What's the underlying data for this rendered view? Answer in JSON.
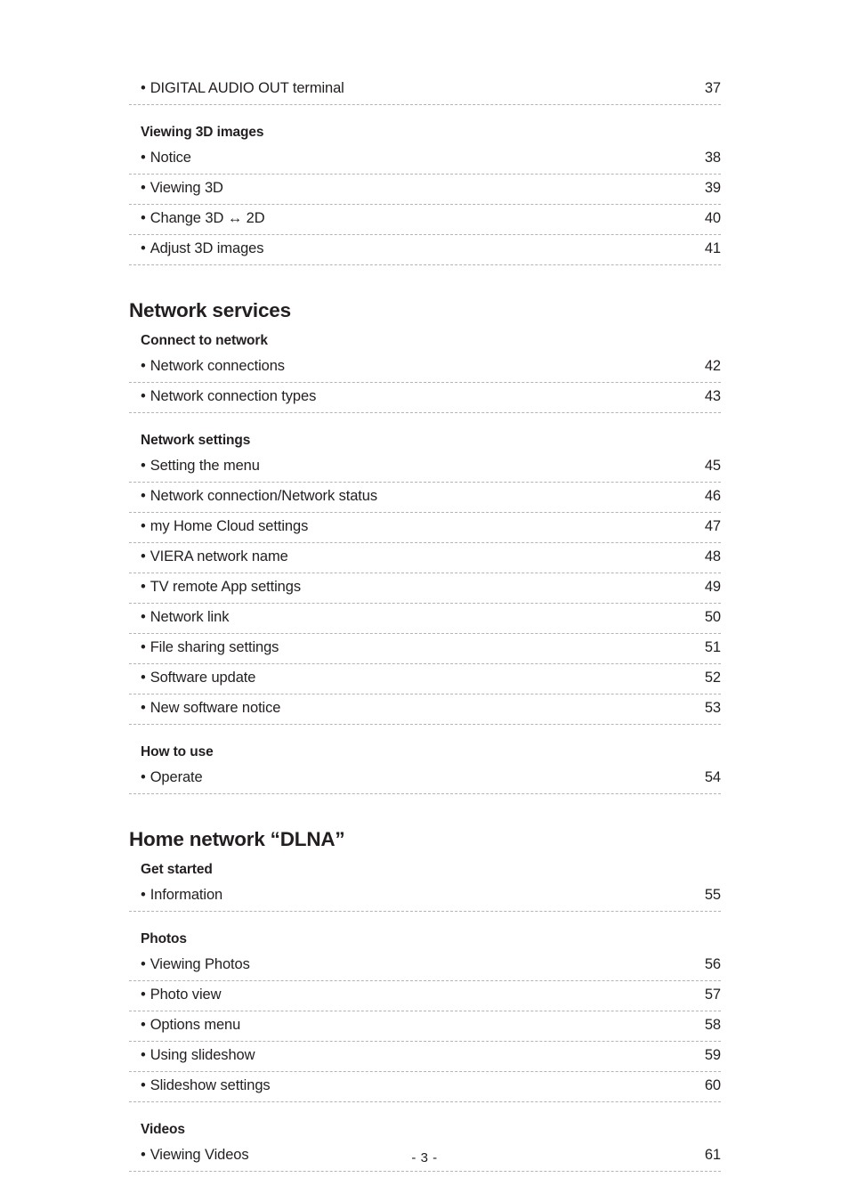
{
  "document": {
    "footer_page_label": "- 3 -",
    "bullet_glyph": "•"
  },
  "toc": {
    "blocks": [
      {
        "section_title": null,
        "groups": [
          {
            "heading": null,
            "entries": [
              {
                "label": "DIGITAL AUDIO OUT terminal",
                "page": "37"
              }
            ]
          },
          {
            "heading": "Viewing 3D images",
            "entries": [
              {
                "label": "Notice",
                "page": "38"
              },
              {
                "label": "Viewing 3D",
                "page": "39"
              },
              {
                "label": "Change 3D ↔ 2D",
                "page": "40"
              },
              {
                "label": "Adjust 3D images",
                "page": "41"
              }
            ]
          }
        ]
      },
      {
        "section_title": "Network services",
        "groups": [
          {
            "heading": "Connect to network",
            "entries": [
              {
                "label": "Network connections",
                "page": "42"
              },
              {
                "label": "Network connection types",
                "page": "43"
              }
            ]
          },
          {
            "heading": "Network settings",
            "entries": [
              {
                "label": "Setting the menu",
                "page": "45"
              },
              {
                "label": "Network connection/Network status",
                "page": "46"
              },
              {
                "label": "my Home Cloud settings",
                "page": "47"
              },
              {
                "label": "VIERA network name",
                "page": "48"
              },
              {
                "label": "TV remote App settings",
                "page": "49"
              },
              {
                "label": "Network link",
                "page": "50"
              },
              {
                "label": "File sharing settings",
                "page": "51"
              },
              {
                "label": "Software update",
                "page": "52"
              },
              {
                "label": "New software notice",
                "page": "53"
              }
            ]
          },
          {
            "heading": "How to use",
            "entries": [
              {
                "label": "Operate",
                "page": "54"
              }
            ]
          }
        ]
      },
      {
        "section_title": "Home network “DLNA”",
        "groups": [
          {
            "heading": "Get started",
            "entries": [
              {
                "label": "Information",
                "page": "55"
              }
            ]
          },
          {
            "heading": "Photos",
            "entries": [
              {
                "label": "Viewing Photos",
                "page": "56"
              },
              {
                "label": "Photo view",
                "page": "57"
              },
              {
                "label": "Options menu",
                "page": "58"
              },
              {
                "label": "Using slideshow",
                "page": "59"
              },
              {
                "label": "Slideshow settings",
                "page": "60"
              }
            ]
          },
          {
            "heading": "Videos",
            "entries": [
              {
                "label": "Viewing Videos",
                "page": "61"
              }
            ]
          }
        ]
      }
    ]
  }
}
